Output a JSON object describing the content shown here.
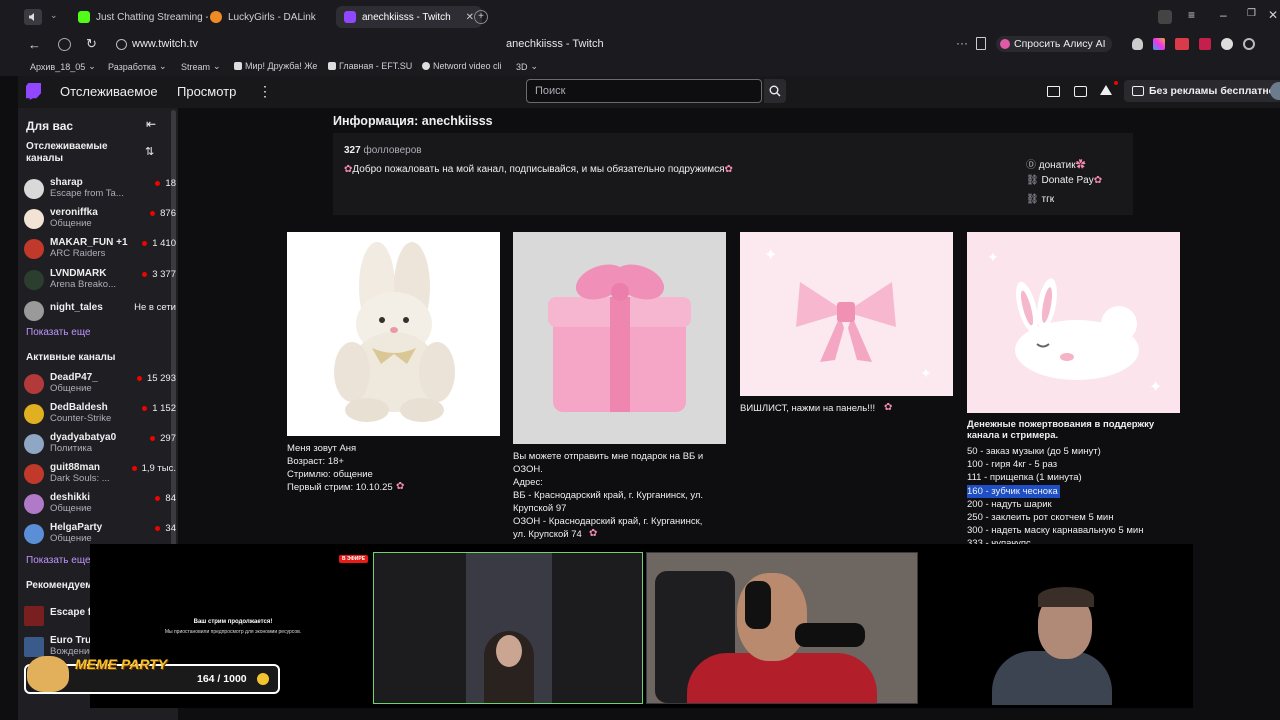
{
  "browser": {
    "tabs": [
      {
        "label": "Just Chatting Streaming -",
        "color": "#53fc18"
      },
      {
        "label": "LuckyGirls - DALink",
        "color": "#f08a24"
      },
      {
        "label": "anechkiisss - Twitch",
        "color": "#9146ff"
      }
    ],
    "address": "www.twitch.tv",
    "page_title": "anechkiisss - Twitch",
    "alice_button": "Спросить Алису AI",
    "bookmarks": [
      "Архив_18_05",
      "Разработка",
      "Stream",
      "Мир! Дружба! Же",
      "Главная - EFT.SU",
      "Netword video cli",
      "3D"
    ]
  },
  "twitch_nav": {
    "following": "Отслеживаемое",
    "browse": "Просмотр",
    "search_placeholder": "Поиск",
    "no_ads": "Без рекламы бесплатно"
  },
  "sidebar": {
    "for_you": "Для вас",
    "followed_title_1": "Отслеживаемые",
    "followed_title_2": "каналы",
    "followed": [
      {
        "name": "sharap",
        "game": "Escape from Ta...",
        "viewers": "18",
        "color": "#d9d9d9"
      },
      {
        "name": "veroniffka",
        "game": "Общение",
        "viewers": "876",
        "color": "#f2e3d5"
      },
      {
        "name": "MAKAR_FUN +1",
        "game": "ARC Raiders",
        "viewers": "1 410",
        "color": "#c0392b"
      },
      {
        "name": "LVNDMARK",
        "game": "Arena Breako...",
        "viewers": "3 377",
        "color": "#2c3e2d"
      },
      {
        "name": "night_tales",
        "game": "",
        "viewers": "",
        "color": "#9a9a9a"
      }
    ],
    "offline": "Не в сети",
    "show_more": "Показать еще",
    "active_title": "Активные каналы",
    "active": [
      {
        "name": "DeadP47_",
        "game": "Общение",
        "viewers": "15 293",
        "color": "#b33a3a"
      },
      {
        "name": "DedBaldesh",
        "game": "Counter-Strike",
        "viewers": "1 152",
        "color": "#e0b020"
      },
      {
        "name": "dyadyabatya0",
        "game": "Политика",
        "viewers": "297",
        "color": "#8fa6c4"
      },
      {
        "name": "guit88man",
        "game": "Dark Souls: ...",
        "viewers": "1,9 тыс.",
        "color": "#c0392b"
      },
      {
        "name": "deshikki",
        "game": "Общение",
        "viewers": "84",
        "color": "#b07ac8"
      },
      {
        "name": "HelgaParty",
        "game": "Общение",
        "viewers": "34",
        "color": "#5a8fd8"
      }
    ],
    "show_more_2": "Показать еще",
    "recommended_title": "Рекомендуемы",
    "recommended": [
      {
        "name": "Escape fr",
        "game": "",
        "color": "#7a1f1f"
      },
      {
        "name": "Euro Truc",
        "game": "Вождение",
        "color": "#3a5a8a"
      }
    ]
  },
  "channel_info": {
    "title": "Информация: anechkiisss",
    "followers_count": "327",
    "followers_label": "фолловеров",
    "description": "Добро пожаловать на мой канал, подписывайся, и мы обязательно подружимся",
    "links": [
      "донатик",
      "Donate Pay",
      "тгк"
    ]
  },
  "panels": [
    {
      "text": "Меня зовут Аня\nВозраст: 18+\nСтримлю: общение\nПервый стрим: 10.10.25"
    },
    {
      "text": "Вы можете отправить мне подарок на ВБ и\nОЗОН.\nАдрес:\nВБ - Краснодарский край, г. Курганинск, ул.\nКрупской 97\nОЗОН - Краснодарский край, г. Курганинск,\nул. Крупской 74"
    },
    {
      "text": "ВИШЛИСТ, нажми на панель!!!"
    },
    {
      "title": "Денежные пожертвования в поддержку\nканала и стримера.",
      "items": [
        "50 - заказ музыки (до 5 минут)",
        "100 - гиря 4кг - 5 раз",
        "111 - прищепка (1 минута)",
        "160 - зубчик чеснока",
        "200 - надуть шарик",
        "250 - заклеить рот скотчем 5 мин",
        "300 - надеть маску карнавальную 5 мин",
        "333 - чупачупс"
      ]
    }
  ],
  "overlay": {
    "live_badge": "В ЭФИРЕ",
    "paused_title": "Ваш стрим продолжается!",
    "paused_sub": "Мы приостановили предпросмотр для экономии ресурсов.",
    "meme_title": "MEME PARTY",
    "meme_counter": "164 / 1000"
  }
}
